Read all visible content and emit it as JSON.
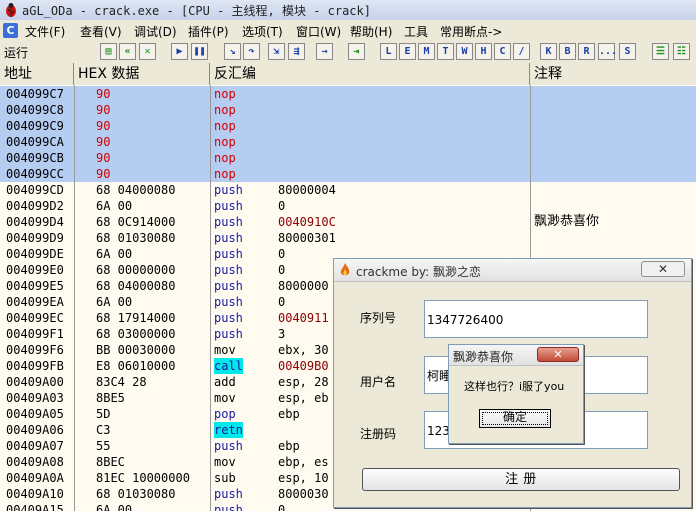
{
  "window": {
    "title": "aGL_ODa - crack.exe - [CPU - 主线程, 模块 - crack]"
  },
  "menu": [
    "文件(F)",
    "查看(V)",
    "调试(D)",
    "插件(P)",
    "选项(T)",
    "窗口(W)",
    "帮助(H)",
    "工具",
    "常用断点->"
  ],
  "toolbar": {
    "status": "运行",
    "buttons": [
      "L",
      "E",
      "M",
      "T",
      "W",
      "H",
      "C",
      "/",
      "K",
      "B",
      "R",
      "...",
      "S"
    ]
  },
  "columns": {
    "address": "地址",
    "hex": "HEX 数据",
    "disasm": "反汇编",
    "comment": "注释"
  },
  "rows": [
    {
      "addr": "004099C7",
      "hex": "90",
      "mnem": "nop",
      "opnd": "",
      "cmt": "",
      "sel": true
    },
    {
      "addr": "004099C8",
      "hex": "90",
      "mnem": "nop",
      "opnd": "",
      "cmt": "",
      "sel": true
    },
    {
      "addr": "004099C9",
      "hex": "90",
      "mnem": "nop",
      "opnd": "",
      "cmt": "",
      "sel": true
    },
    {
      "addr": "004099CA",
      "hex": "90",
      "mnem": "nop",
      "opnd": "",
      "cmt": "",
      "sel": true
    },
    {
      "addr": "004099CB",
      "hex": "90",
      "mnem": "nop",
      "opnd": "",
      "cmt": "",
      "sel": true
    },
    {
      "addr": "004099CC",
      "hex": "90",
      "mnem": "nop",
      "opnd": "",
      "cmt": "",
      "sel": true
    },
    {
      "addr": "004099CD",
      "hex": "68 04000080",
      "mnem": "push",
      "opnd": "80000004",
      "cmt": ""
    },
    {
      "addr": "004099D2",
      "hex": "6A 00",
      "mnem": "push",
      "opnd": "0",
      "cmt": ""
    },
    {
      "addr": "004099D4",
      "hex": "68 0C914000",
      "mnem": "push",
      "opnd": "0040910C",
      "cmt": "飘渺恭喜你"
    },
    {
      "addr": "004099D9",
      "hex": "68 01030080",
      "mnem": "push",
      "opnd": "80000301",
      "cmt": ""
    },
    {
      "addr": "004099DE",
      "hex": "6A 00",
      "mnem": "push",
      "opnd": "0",
      "cmt": ""
    },
    {
      "addr": "004099E0",
      "hex": "68 00000000",
      "mnem": "push",
      "opnd": "0",
      "cmt": ""
    },
    {
      "addr": "004099E5",
      "hex": "68 04000080",
      "mnem": "push",
      "opnd": "8000000",
      "cmt": ""
    },
    {
      "addr": "004099EA",
      "hex": "6A 00",
      "mnem": "push",
      "opnd": "0",
      "cmt": ""
    },
    {
      "addr": "004099EC",
      "hex": "68 17914000",
      "mnem": "push",
      "opnd": "0040911",
      "cmt": ""
    },
    {
      "addr": "004099F1",
      "hex": "68 03000000",
      "mnem": "push",
      "opnd": "3",
      "cmt": ""
    },
    {
      "addr": "004099F6",
      "hex": "BB 00030000",
      "mnem": "mov",
      "opnd": "ebx, 30",
      "cmt": ""
    },
    {
      "addr": "004099FB",
      "hex": "E8 06010000",
      "mnem": "call",
      "opnd": "00409B0",
      "cmt": ""
    },
    {
      "addr": "00409A00",
      "hex": "83C4 28",
      "mnem": "add",
      "opnd": "esp, 28",
      "cmt": ""
    },
    {
      "addr": "00409A03",
      "hex": "8BE5",
      "mnem": "mov",
      "opnd": "esp, eb",
      "cmt": ""
    },
    {
      "addr": "00409A05",
      "hex": "5D",
      "mnem": "pop",
      "opnd": "ebp",
      "cmt": ""
    },
    {
      "addr": "00409A06",
      "hex": "C3",
      "mnem": "retn",
      "opnd": "",
      "cmt": ""
    },
    {
      "addr": "00409A07",
      "hex": "55",
      "mnem": "push",
      "opnd": "ebp",
      "cmt": ""
    },
    {
      "addr": "00409A08",
      "hex": "8BEC",
      "mnem": "mov",
      "opnd": "ebp, es",
      "cmt": ""
    },
    {
      "addr": "00409A0A",
      "hex": "81EC 10000000",
      "mnem": "sub",
      "opnd": "esp, 10",
      "cmt": ""
    },
    {
      "addr": "00409A10",
      "hex": "68 01030080",
      "mnem": "push",
      "opnd": "8000030",
      "cmt": ""
    },
    {
      "addr": "00409A15",
      "hex": "6A 00",
      "mnem": "push",
      "opnd": "0",
      "cmt": ""
    }
  ],
  "crackme": {
    "title": "crackme by: 飘渺之恋",
    "serial_label": "序列号",
    "serial_value": "1347726400",
    "user_label": "用户名",
    "user_value": "柯睡",
    "code_label": "注册码",
    "code_value": "1234",
    "register_label": "注        册"
  },
  "msgbox": {
    "title": "飘渺恭喜你",
    "message": "这样也行？i服了you",
    "ok_label": "确定"
  },
  "colors": {
    "selection": "#b5cdf0",
    "hex_red": "#d00000",
    "mnem_red": "#d00000",
    "call_highlight": "#00e8e8"
  }
}
